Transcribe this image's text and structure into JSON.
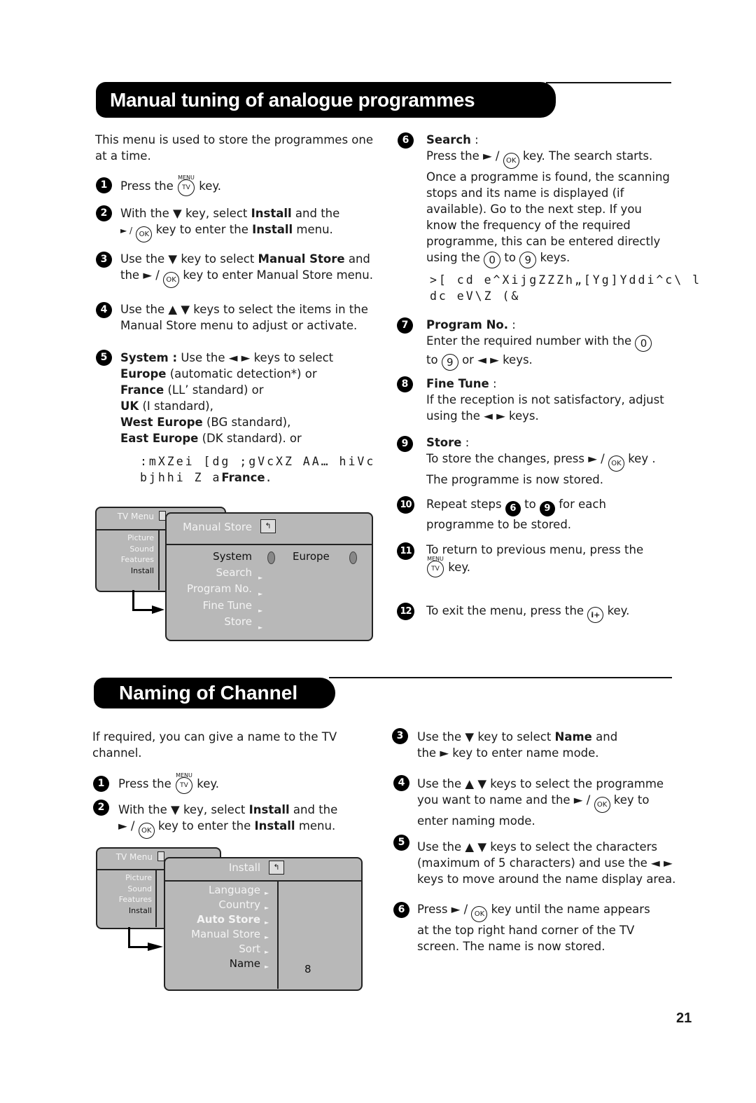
{
  "section1": {
    "title": "Manual tuning of analogue programmes",
    "intro": "This menu is used to store the programmes one at a time.",
    "steps": [
      {
        "num": "1",
        "pre": "Press the",
        "key_label": "MENU",
        "key": "TV",
        "post": "key."
      },
      {
        "num": "2",
        "line1_a": "With the ▼ key, select",
        "line1_b": "Install",
        "line1_c": "and the",
        "line2_a": "► /",
        "key": "OK",
        "line2_b": "key to enter the",
        "line2_c": "Install",
        "line2_d": "menu."
      },
      {
        "num": "3",
        "line1_a": "Use the ▼ key to select",
        "line1_b": "Manual Store",
        "line1_c": "and",
        "line2_a": "the ► /",
        "key": "OK",
        "line2_b": "key to enter Manual Store menu."
      },
      {
        "num": "4",
        "line1": "Use the ▲ ▼ keys to select the items in the",
        "line2": "Manual Store menu to adjust or activate."
      },
      {
        "num": "5",
        "label": "System :",
        "line1": "Use the ◄ ► keys to select",
        "options": [
          {
            "bold": "Europe",
            "text": "(automatic detection*) or"
          },
          {
            "bold": "France",
            "text": "(LL’ standard) or"
          },
          {
            "bold": "UK",
            "text": "(I standard),"
          },
          {
            "bold": "West Europe",
            "text": "(BG standard),"
          },
          {
            "bold": "East Europe",
            "text": "(DK standard). or"
          }
        ],
        "garbled1": ":mXZei [dg ;gVcXZ AA… hiVc",
        "garbled2": "bjhhi Z a",
        "garbled2_bold": "France",
        "garbled2_end": "."
      },
      {
        "num": "6",
        "label": "Search",
        "colon": ":",
        "line1_a": "Press the ► /",
        "key": "OK",
        "line1_b": "key. The search starts.",
        "body": "Once a programme is found, the scanning stops and its name is displayed (if available). Go to the next step. If you know the frequency of the required programme, this can be entered directly using the",
        "digit_from": "0",
        "to": "to",
        "digit_to": "9",
        "end": "keys.",
        "garbled1": ">[ cd e^XijgZZZh„[Yg]Yddi^c\\ l",
        "garbled2": "dc eV\\Z (&"
      },
      {
        "num": "7",
        "label": "Program No.",
        "colon": ":",
        "line1": "Enter the required number with the",
        "digit_from": "0",
        "to": "to",
        "digit_to": "9",
        "line2_end": "or ◄ ► keys."
      },
      {
        "num": "8",
        "label": "Fine Tune",
        "colon": ":",
        "line1": "If the reception is not satisfactory, adjust",
        "line2": "using the ◄ ► keys."
      },
      {
        "num": "9",
        "label": "Store",
        "colon": ":",
        "line1_a": "To store the changes, press ► /",
        "key": "OK",
        "line1_b": "key .",
        "line2": "The programme is now stored."
      },
      {
        "num": "10",
        "pre": "Repeat steps",
        "ref_from": "6",
        "to": "to",
        "ref_to": "9",
        "post": "for each",
        "line2": "programme to be stored."
      },
      {
        "num": "11",
        "line1": "To return to previous menu, press the",
        "key_label": "MENU",
        "key": "TV",
        "post": "key."
      },
      {
        "num": "12",
        "pre": "To exit the menu, press the",
        "key": "i+",
        "post": "key."
      }
    ],
    "menu": {
      "back_title": "TV Menu",
      "back_items": [
        "Picture",
        "Sound",
        "Features",
        "Install"
      ],
      "front_title": "Manual Store",
      "items": [
        "System",
        "Search",
        "Program No.",
        "Fine Tune",
        "Store"
      ],
      "system_value": "Europe"
    }
  },
  "section2": {
    "title": "Naming of Channel",
    "intro": "If required, you can give a name to the TV channel.",
    "steps": [
      {
        "num": "1",
        "pre": "Press the",
        "key_label": "MENU",
        "key": "TV",
        "post": "key."
      },
      {
        "num": "2",
        "line1_a": "With the ▼ key, select",
        "line1_b": "Install",
        "line1_c": "and the",
        "line2_a": "► /",
        "key": "OK",
        "line2_b": "key to enter the",
        "line2_c": "Install",
        "line2_d": "menu."
      },
      {
        "num": "3",
        "line1_a": "Use the ▼ key to select",
        "line1_b": "Name",
        "line1_c": "and",
        "line2": "the ► key to enter name mode."
      },
      {
        "num": "4",
        "line1": "Use the ▲ ▼ keys to select the programme",
        "line2_a": "you want to name and the ► /",
        "key": "OK",
        "line2_b": "key to",
        "line3": "enter naming mode."
      },
      {
        "num": "5",
        "line1": "Use the ▲ ▼ keys to select the characters",
        "line2": "(maximum of 5 characters) and use the ◄ ►",
        "line3": "keys to move around the name display area."
      },
      {
        "num": "6",
        "line1_a": "Press ► /",
        "key": "OK",
        "line1_b": "key until the name appears",
        "line2": "at the top right hand corner of the TV",
        "line3": "screen. The name is now stored."
      }
    ],
    "menu": {
      "back_title": "TV Menu",
      "back_items": [
        "Picture",
        "Sound",
        "Features",
        "Install"
      ],
      "front_title": "Install",
      "items": [
        "Language",
        "Country",
        "Auto Store",
        "Manual Store",
        "Sort",
        "Name"
      ],
      "value": "8"
    }
  },
  "page_number": "21"
}
